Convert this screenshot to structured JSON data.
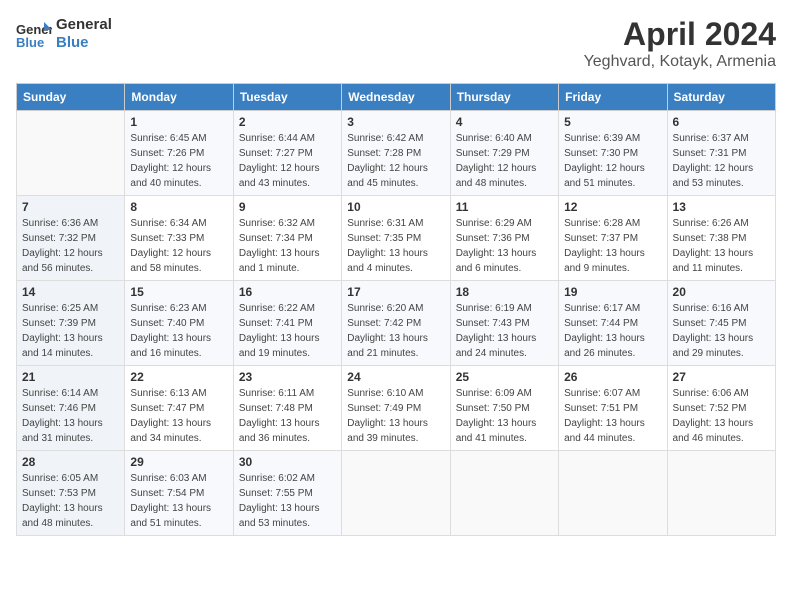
{
  "header": {
    "logo_line1": "General",
    "logo_line2": "Blue",
    "month_year": "April 2024",
    "location": "Yeghvard, Kotayk, Armenia"
  },
  "days_of_week": [
    "Sunday",
    "Monday",
    "Tuesday",
    "Wednesday",
    "Thursday",
    "Friday",
    "Saturday"
  ],
  "weeks": [
    [
      {
        "day": "",
        "info": ""
      },
      {
        "day": "1",
        "info": "Sunrise: 6:45 AM\nSunset: 7:26 PM\nDaylight: 12 hours\nand 40 minutes."
      },
      {
        "day": "2",
        "info": "Sunrise: 6:44 AM\nSunset: 7:27 PM\nDaylight: 12 hours\nand 43 minutes."
      },
      {
        "day": "3",
        "info": "Sunrise: 6:42 AM\nSunset: 7:28 PM\nDaylight: 12 hours\nand 45 minutes."
      },
      {
        "day": "4",
        "info": "Sunrise: 6:40 AM\nSunset: 7:29 PM\nDaylight: 12 hours\nand 48 minutes."
      },
      {
        "day": "5",
        "info": "Sunrise: 6:39 AM\nSunset: 7:30 PM\nDaylight: 12 hours\nand 51 minutes."
      },
      {
        "day": "6",
        "info": "Sunrise: 6:37 AM\nSunset: 7:31 PM\nDaylight: 12 hours\nand 53 minutes."
      }
    ],
    [
      {
        "day": "7",
        "info": "Sunrise: 6:36 AM\nSunset: 7:32 PM\nDaylight: 12 hours\nand 56 minutes."
      },
      {
        "day": "8",
        "info": "Sunrise: 6:34 AM\nSunset: 7:33 PM\nDaylight: 12 hours\nand 58 minutes."
      },
      {
        "day": "9",
        "info": "Sunrise: 6:32 AM\nSunset: 7:34 PM\nDaylight: 13 hours\nand 1 minute."
      },
      {
        "day": "10",
        "info": "Sunrise: 6:31 AM\nSunset: 7:35 PM\nDaylight: 13 hours\nand 4 minutes."
      },
      {
        "day": "11",
        "info": "Sunrise: 6:29 AM\nSunset: 7:36 PM\nDaylight: 13 hours\nand 6 minutes."
      },
      {
        "day": "12",
        "info": "Sunrise: 6:28 AM\nSunset: 7:37 PM\nDaylight: 13 hours\nand 9 minutes."
      },
      {
        "day": "13",
        "info": "Sunrise: 6:26 AM\nSunset: 7:38 PM\nDaylight: 13 hours\nand 11 minutes."
      }
    ],
    [
      {
        "day": "14",
        "info": "Sunrise: 6:25 AM\nSunset: 7:39 PM\nDaylight: 13 hours\nand 14 minutes."
      },
      {
        "day": "15",
        "info": "Sunrise: 6:23 AM\nSunset: 7:40 PM\nDaylight: 13 hours\nand 16 minutes."
      },
      {
        "day": "16",
        "info": "Sunrise: 6:22 AM\nSunset: 7:41 PM\nDaylight: 13 hours\nand 19 minutes."
      },
      {
        "day": "17",
        "info": "Sunrise: 6:20 AM\nSunset: 7:42 PM\nDaylight: 13 hours\nand 21 minutes."
      },
      {
        "day": "18",
        "info": "Sunrise: 6:19 AM\nSunset: 7:43 PM\nDaylight: 13 hours\nand 24 minutes."
      },
      {
        "day": "19",
        "info": "Sunrise: 6:17 AM\nSunset: 7:44 PM\nDaylight: 13 hours\nand 26 minutes."
      },
      {
        "day": "20",
        "info": "Sunrise: 6:16 AM\nSunset: 7:45 PM\nDaylight: 13 hours\nand 29 minutes."
      }
    ],
    [
      {
        "day": "21",
        "info": "Sunrise: 6:14 AM\nSunset: 7:46 PM\nDaylight: 13 hours\nand 31 minutes."
      },
      {
        "day": "22",
        "info": "Sunrise: 6:13 AM\nSunset: 7:47 PM\nDaylight: 13 hours\nand 34 minutes."
      },
      {
        "day": "23",
        "info": "Sunrise: 6:11 AM\nSunset: 7:48 PM\nDaylight: 13 hours\nand 36 minutes."
      },
      {
        "day": "24",
        "info": "Sunrise: 6:10 AM\nSunset: 7:49 PM\nDaylight: 13 hours\nand 39 minutes."
      },
      {
        "day": "25",
        "info": "Sunrise: 6:09 AM\nSunset: 7:50 PM\nDaylight: 13 hours\nand 41 minutes."
      },
      {
        "day": "26",
        "info": "Sunrise: 6:07 AM\nSunset: 7:51 PM\nDaylight: 13 hours\nand 44 minutes."
      },
      {
        "day": "27",
        "info": "Sunrise: 6:06 AM\nSunset: 7:52 PM\nDaylight: 13 hours\nand 46 minutes."
      }
    ],
    [
      {
        "day": "28",
        "info": "Sunrise: 6:05 AM\nSunset: 7:53 PM\nDaylight: 13 hours\nand 48 minutes."
      },
      {
        "day": "29",
        "info": "Sunrise: 6:03 AM\nSunset: 7:54 PM\nDaylight: 13 hours\nand 51 minutes."
      },
      {
        "day": "30",
        "info": "Sunrise: 6:02 AM\nSunset: 7:55 PM\nDaylight: 13 hours\nand 53 minutes."
      },
      {
        "day": "",
        "info": ""
      },
      {
        "day": "",
        "info": ""
      },
      {
        "day": "",
        "info": ""
      },
      {
        "day": "",
        "info": ""
      }
    ]
  ]
}
